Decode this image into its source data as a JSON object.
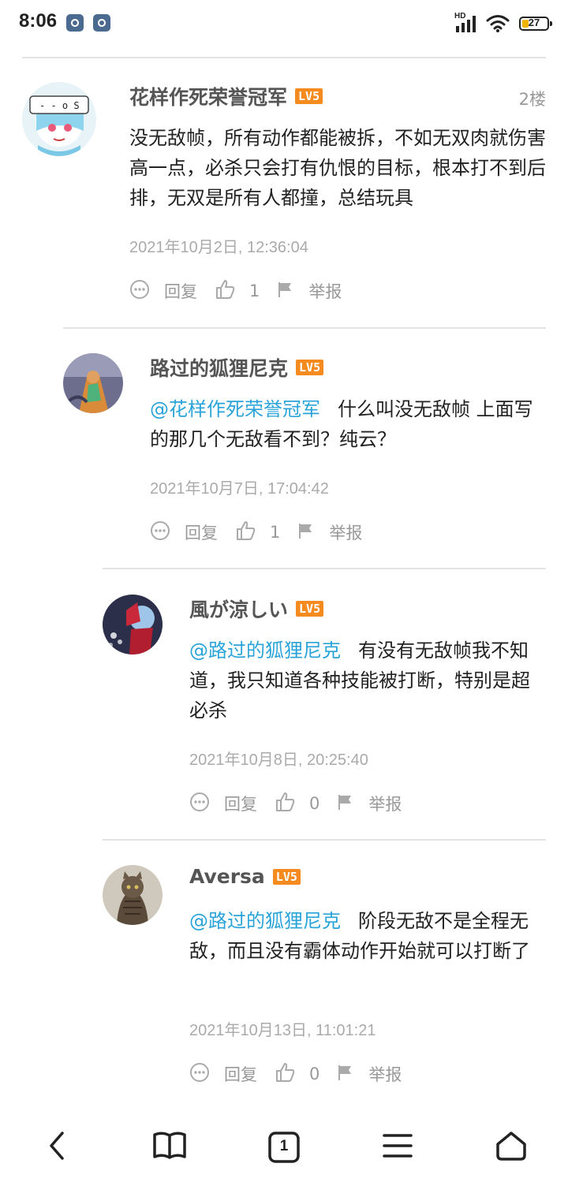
{
  "status_bar": {
    "time": "8:06",
    "network": "HD",
    "battery": "27"
  },
  "comments": [
    {
      "username": "花样作死荣誉冠军",
      "level": "LV5",
      "floor": "2楼",
      "mention": "",
      "text": "没无敌帧，所有动作都能被拆，不如无双肉就伤害高一点，必杀只会打有仇恨的目标，根本打不到后排，无双是所有人都撞，总结玩具",
      "date": "2021年10月2日, 12:36:04",
      "reply_label": "回复",
      "likes": "1",
      "report_label": "举报"
    },
    {
      "username": "路过的狐狸尼克",
      "level": "LV5",
      "mention": "@花样作死荣誉冠军",
      "text": "什么叫没无敌帧 上面写的那几个无敌看不到？纯云？",
      "date": "2021年10月7日, 17:04:42",
      "reply_label": "回复",
      "likes": "1",
      "report_label": "举报"
    },
    {
      "username": "風が涼しい",
      "level": "LV5",
      "mention": "@路过的狐狸尼克",
      "text": "有没有无敌帧我不知道，我只知道各种技能被打断，特别是超必杀",
      "date": "2021年10月8日, 20:25:40",
      "reply_label": "回复",
      "likes": "0",
      "report_label": "举报"
    },
    {
      "username": "Aversa",
      "level": "LV5",
      "mention": "@路过的狐狸尼克",
      "text": "阶段无敌不是全程无敌，而且没有霸体动作开始就可以打断了",
      "date": "2021年10月13日, 11:01:21",
      "reply_label": "回复",
      "likes": "0",
      "report_label": "举报"
    }
  ],
  "bottom_nav": {
    "tab_count": "1",
    "icons": [
      "back-icon",
      "bookmarks-icon",
      "tabs-icon",
      "menu-icon",
      "home-icon"
    ]
  },
  "colors": {
    "mention": "#2aa3d9",
    "level_badge": "#f58a1f",
    "meta_text": "#999999"
  }
}
